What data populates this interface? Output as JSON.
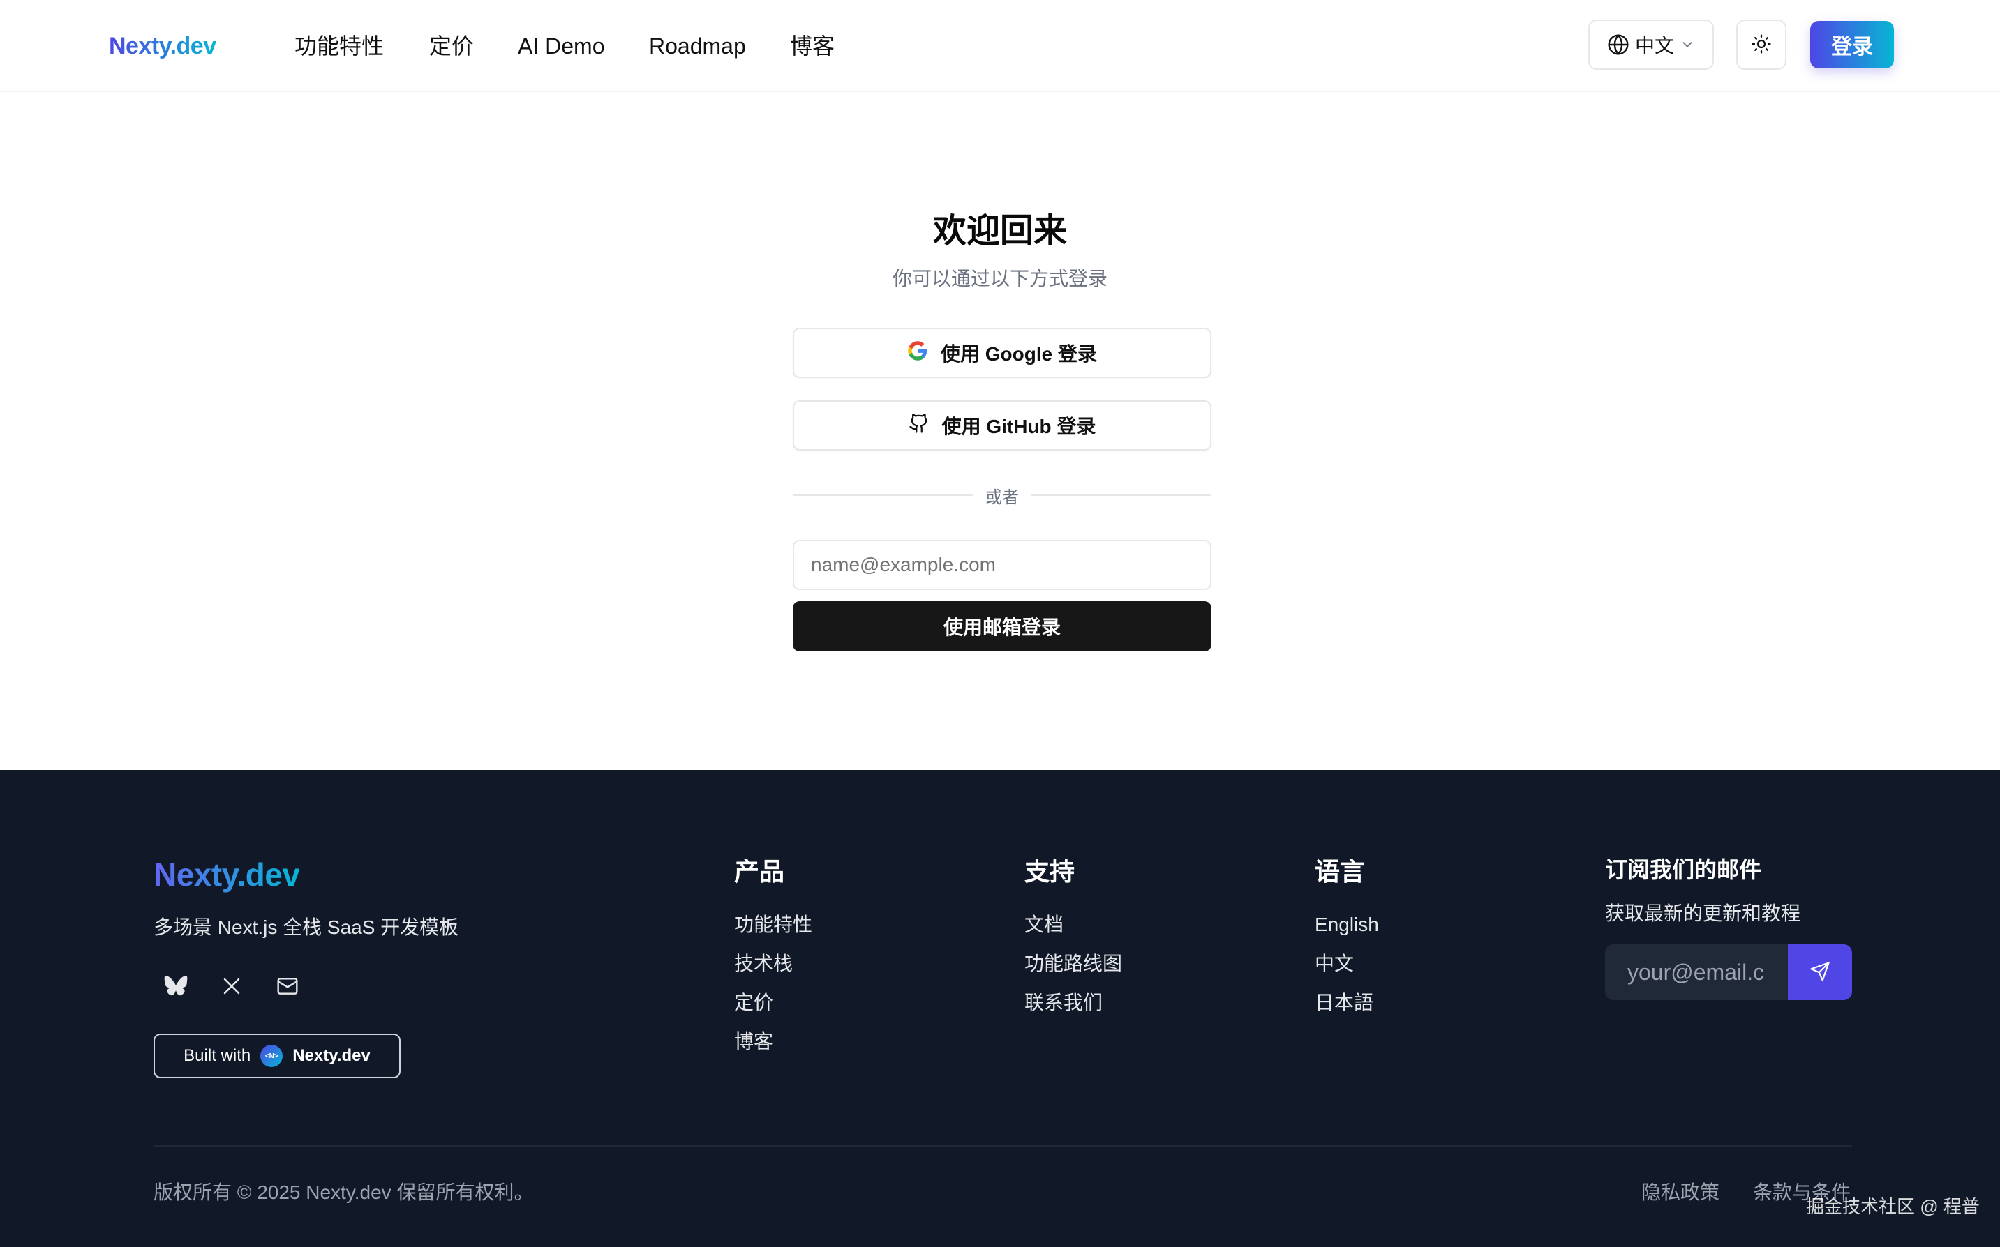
{
  "header": {
    "logo": "Nexty.dev",
    "nav": [
      {
        "label": "功能特性"
      },
      {
        "label": "定价"
      },
      {
        "label": "AI Demo"
      },
      {
        "label": "Roadmap"
      },
      {
        "label": "博客"
      }
    ],
    "language_selector": "中文",
    "login_label": "登录"
  },
  "login": {
    "title": "欢迎回来",
    "subtitle": "你可以通过以下方式登录",
    "google_label": "使用 Google 登录",
    "github_label": "使用 GitHub 登录",
    "divider_text": "或者",
    "email_placeholder": "name@example.com",
    "email_submit_label": "使用邮箱登录"
  },
  "footer": {
    "logo": "Nexty.dev",
    "tagline": "多场景 Next.js 全栈 SaaS 开发模板",
    "social_icons": [
      "bluesky-icon",
      "x-icon",
      "mail-icon"
    ],
    "built_with": {
      "prefix": "Built with",
      "badge": "<N>",
      "brand": "Nexty.dev"
    },
    "columns": [
      {
        "title": "产品",
        "links": [
          "功能特性",
          "技术栈",
          "定价",
          "博客"
        ]
      },
      {
        "title": "支持",
        "links": [
          "文档",
          "功能路线图",
          "联系我们"
        ]
      },
      {
        "title": "语言",
        "links": [
          "English",
          "中文",
          "日本語"
        ]
      }
    ],
    "subscribe": {
      "title": "订阅我们的邮件",
      "description": "获取最新的更新和教程",
      "placeholder": "your@email.c"
    },
    "copyright": "版权所有 © 2025 Nexty.dev 保留所有权利。",
    "legal_links": [
      "隐私政策",
      "条款与条件"
    ]
  },
  "watermark": "掘金技术社区 @ 程普",
  "colors": {
    "brand_gradient_start": "#4f46e5",
    "brand_gradient_end": "#06b6d4",
    "footer_bg": "#111827",
    "primary_button": "#171717"
  }
}
